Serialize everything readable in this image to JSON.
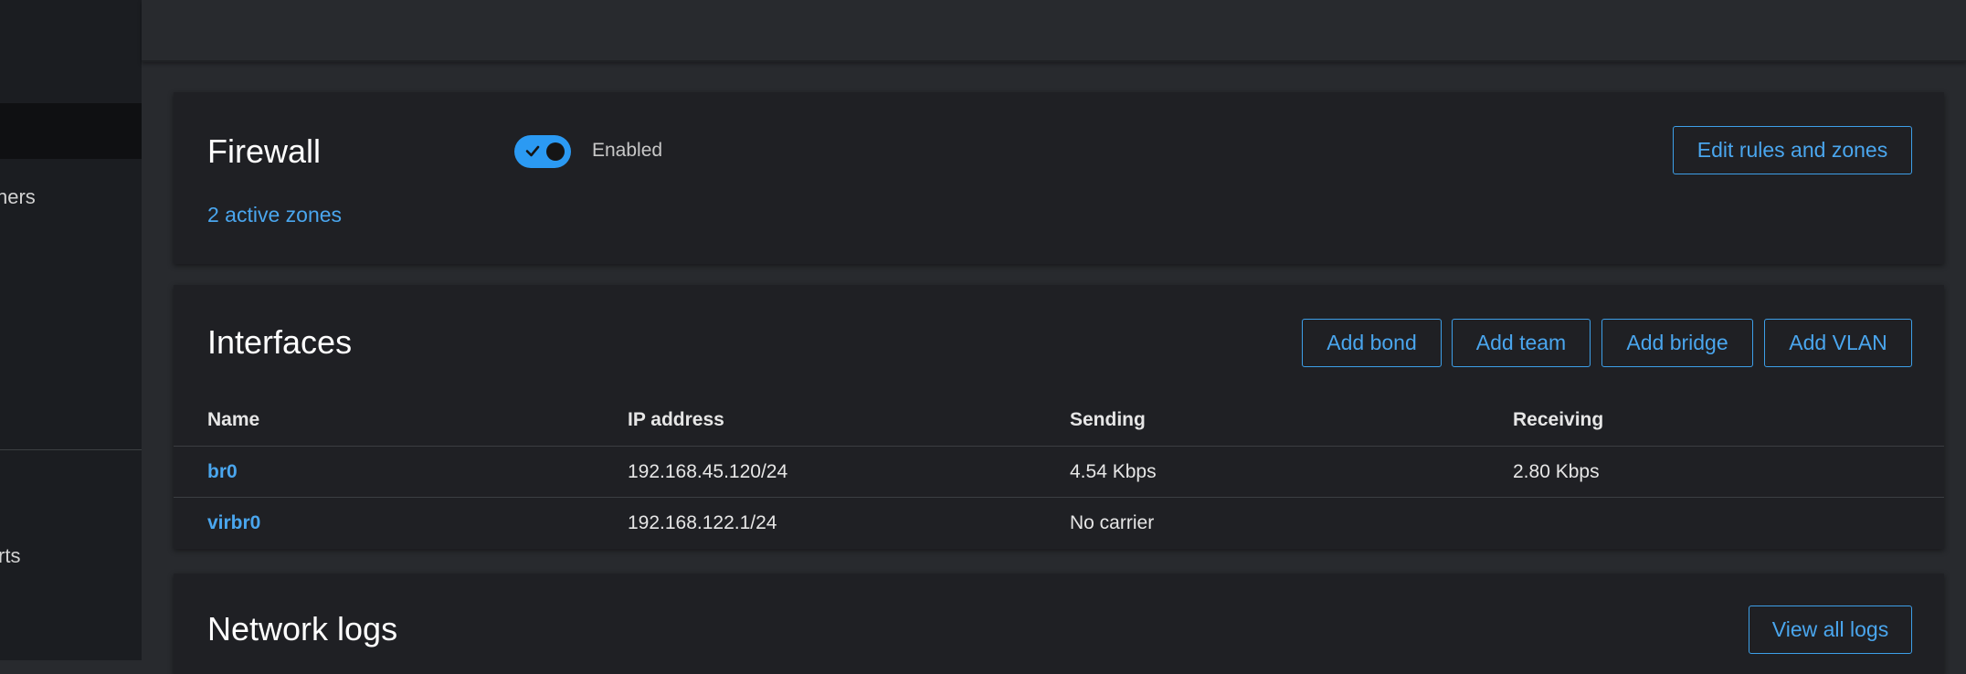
{
  "sidebar": {
    "items": [
      {
        "label": "ners"
      },
      {
        "label": "rts"
      }
    ]
  },
  "firewall": {
    "title": "Firewall",
    "toggle_state": "Enabled",
    "zones_link": "2 active zones",
    "edit_button": "Edit rules and zones"
  },
  "interfaces": {
    "title": "Interfaces",
    "buttons": {
      "add_bond": "Add bond",
      "add_team": "Add team",
      "add_bridge": "Add bridge",
      "add_vlan": "Add VLAN"
    },
    "columns": {
      "name": "Name",
      "ip": "IP address",
      "sending": "Sending",
      "receiving": "Receiving"
    },
    "rows": [
      {
        "name": "br0",
        "ip": "192.168.45.120/24",
        "sending": "4.54 Kbps",
        "receiving": "2.80 Kbps"
      },
      {
        "name": "virbr0",
        "ip": "192.168.122.1/24",
        "sending": "No carrier",
        "receiving": ""
      }
    ]
  },
  "network_logs": {
    "title": "Network logs",
    "view_button": "View all logs"
  },
  "colors": {
    "accent": "#2b9af3",
    "link": "#4aa6ee",
    "background": "#282a2e",
    "card": "#1f2024"
  }
}
